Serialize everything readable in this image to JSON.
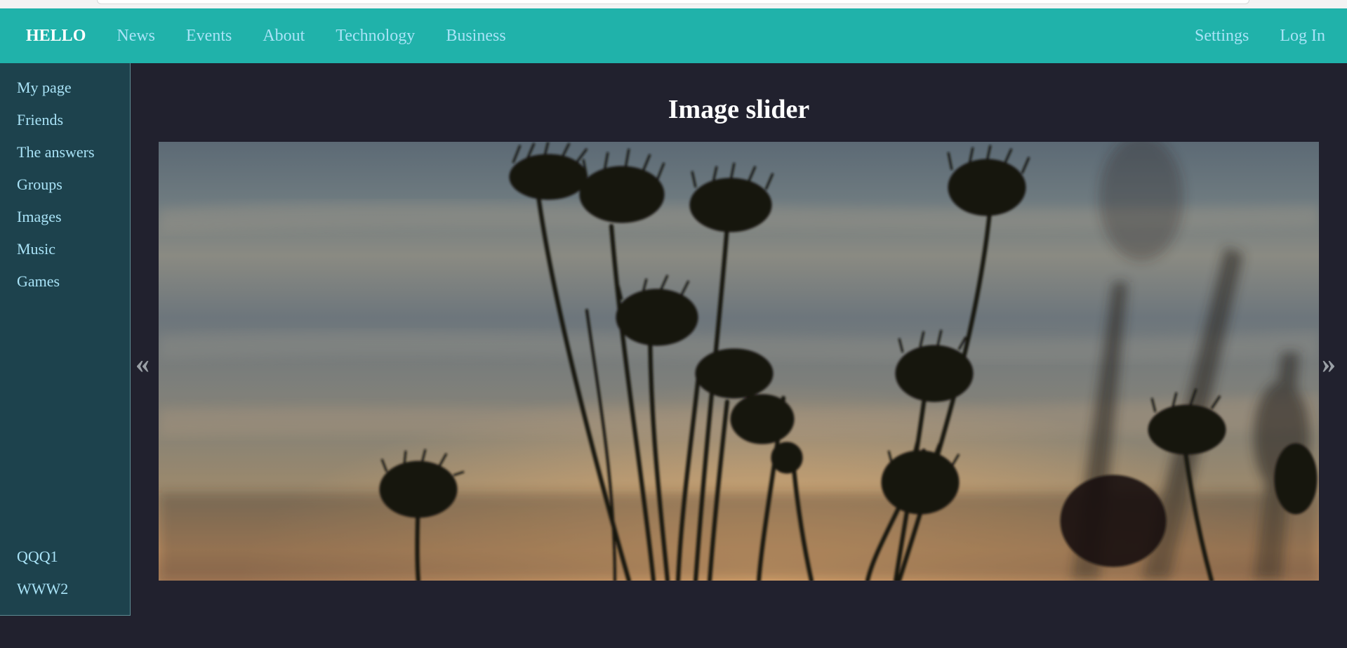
{
  "navbar": {
    "brand": "HELLO",
    "left_links": [
      "News",
      "Events",
      "About",
      "Technology",
      "Business"
    ],
    "right_links": [
      "Settings",
      "Log In"
    ]
  },
  "sidebar": {
    "items": [
      "My page",
      "Friends",
      "The answers",
      "Groups",
      "Images",
      "Music",
      "Games"
    ],
    "bottom_items": [
      "QQQ1",
      "WWW2"
    ]
  },
  "main": {
    "title": "Image slider",
    "slider": {
      "prev_symbol": "«",
      "next_symbol": "»",
      "image_description": "silhouette of thistle flowers against sunset sky"
    }
  },
  "colors": {
    "navbar_bg": "#20b2aa",
    "sidebar_bg": "#1d424d",
    "page_bg": "#21212e",
    "link_color": "#a9e3f7"
  }
}
